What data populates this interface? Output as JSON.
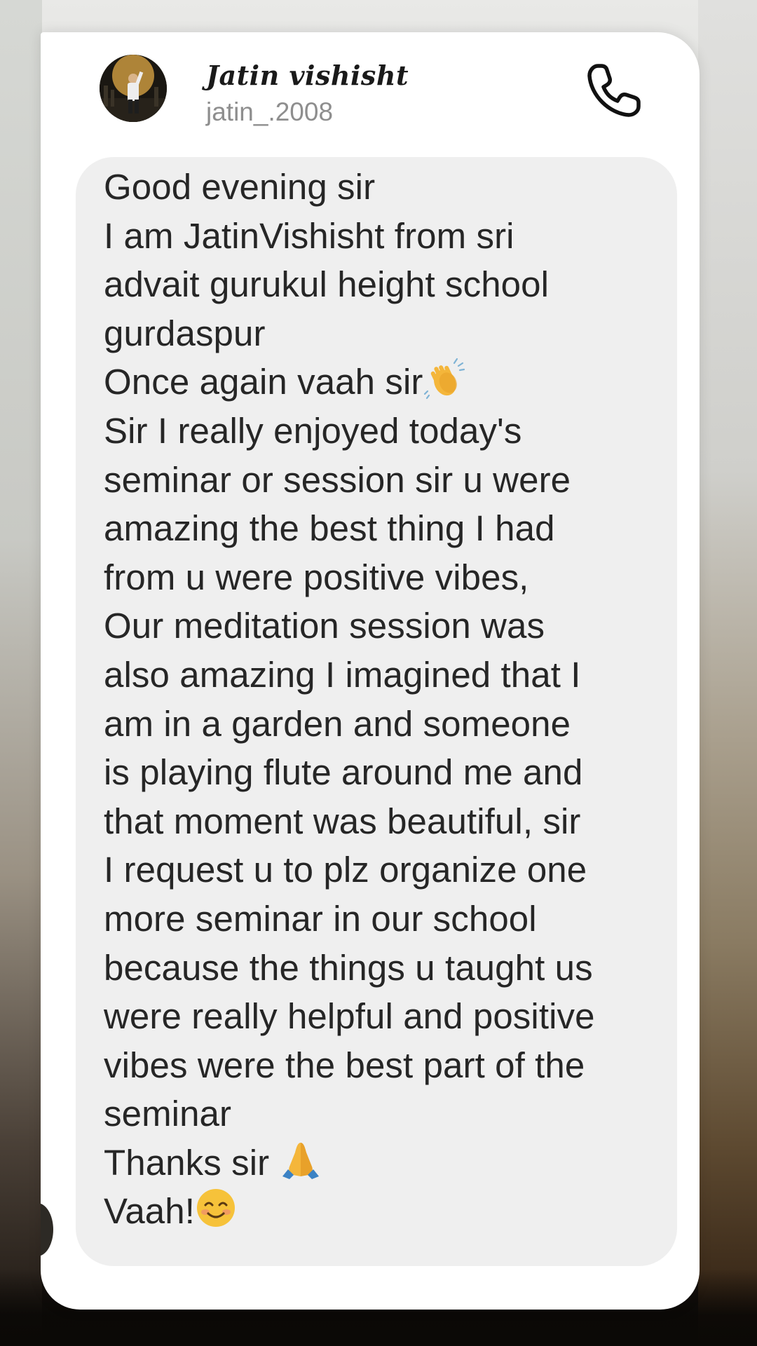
{
  "contact": {
    "display_name": "Jatin vishisht",
    "username": "jatin_.2008"
  },
  "header_icons": {
    "avatar": "avatar-photo",
    "call": "phone-icon"
  },
  "message": {
    "lines": [
      "Good evening sir",
      "I am JatinVishisht from sri",
      "advait gurukul height school",
      "gurdaspur",
      "Once again vaah sir",
      "Sir I really enjoyed today's",
      "seminar or session sir u were",
      "amazing the best thing I had",
      "from u were positive vibes,",
      "Our meditation session was",
      "also amazing I imagined that I",
      "am in a garden and someone",
      "is playing flute around me and",
      "that moment was beautiful, sir",
      "I request u to plz organize one",
      "more seminar in our school",
      "because the things u taught us",
      "were really helpful and positive",
      "vibes were the best part of the",
      "seminar",
      "Thanks sir ",
      "Vaah!"
    ],
    "emojis": [
      "clapping-hands-emoji",
      "folded-hands-emoji",
      "smiling-face-emoji"
    ]
  },
  "colors": {
    "card": "#ffffff",
    "bubble": "#efefef",
    "text": "#262626",
    "username": "#8e8e8e"
  }
}
